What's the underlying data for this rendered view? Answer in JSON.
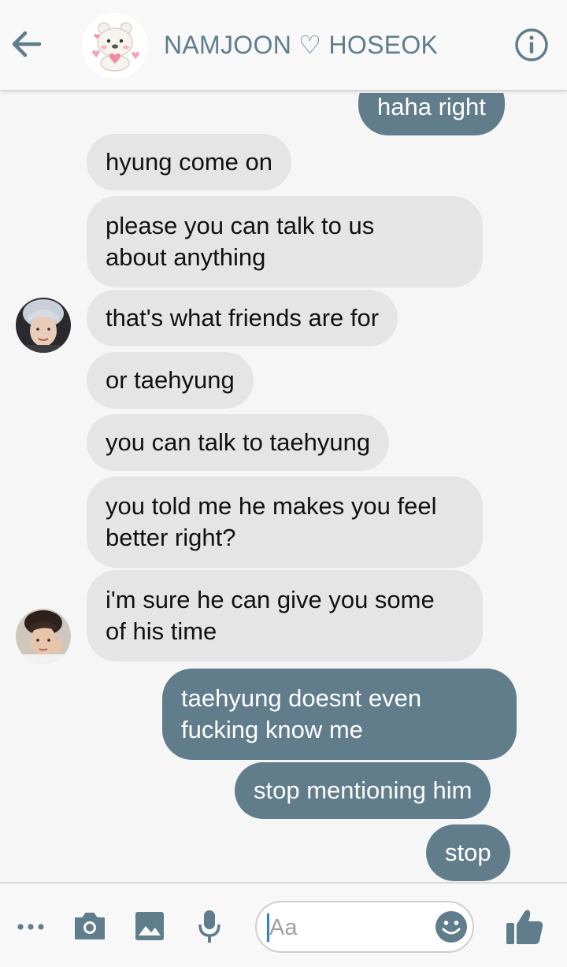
{
  "header": {
    "title": "NAMJOON ♡ HOSEOK",
    "back_icon": "arrow-left-icon",
    "info_icon": "info-icon",
    "avatar_icon": "bear-sticker-avatar"
  },
  "messages": [
    {
      "id": "m0",
      "side": "out",
      "lines": [
        "haha right"
      ]
    },
    {
      "id": "m1",
      "side": "in",
      "lines": [
        "hyung come on"
      ]
    },
    {
      "id": "m2",
      "side": "in",
      "lines": [
        "please you can talk to us",
        "about anything"
      ]
    },
    {
      "id": "m3",
      "side": "in",
      "lines": [
        "that's what friends are for"
      ]
    },
    {
      "id": "m4",
      "side": "in",
      "lines": [
        "or taehyung"
      ]
    },
    {
      "id": "m5",
      "side": "in",
      "lines": [
        "you can talk to taehyung"
      ]
    },
    {
      "id": "m6",
      "side": "in",
      "lines": [
        "you told me he makes you feel",
        "better right?"
      ]
    },
    {
      "id": "m7",
      "side": "in",
      "lines": [
        "i'm sure he can give you some",
        "of his time"
      ]
    },
    {
      "id": "m8",
      "side": "out",
      "lines": [
        "taehyung doesnt even",
        "fucking know me"
      ]
    },
    {
      "id": "m9",
      "side": "out",
      "lines": [
        "stop mentioning him"
      ]
    },
    {
      "id": "m10",
      "side": "out",
      "lines": [
        "stop"
      ]
    }
  ],
  "composer": {
    "placeholder": "Aa",
    "icons": [
      "more-icon",
      "camera-icon",
      "image-icon",
      "microphone-icon",
      "emoji-icon",
      "thumbs-up-icon"
    ]
  },
  "colors": {
    "accent": "#617d8c",
    "incoming_bubble": "#e5e5e5",
    "background": "#f6f6f6"
  }
}
